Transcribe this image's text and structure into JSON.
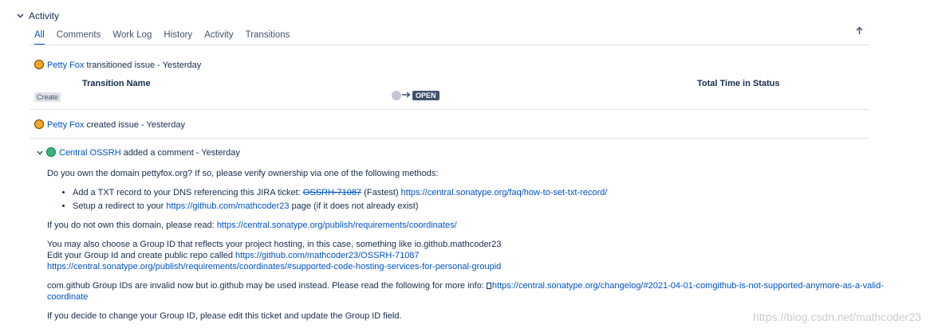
{
  "section": {
    "title": "Activity"
  },
  "tabs": [
    {
      "label": "All",
      "active": true
    },
    {
      "label": "Comments"
    },
    {
      "label": "Work Log"
    },
    {
      "label": "History"
    },
    {
      "label": "Activity"
    },
    {
      "label": "Transitions"
    }
  ],
  "entry1": {
    "user": "Petty Fox",
    "action": " transitioned issue - Yesterday",
    "table": {
      "col1": "Transition Name",
      "col2": "Total Time in Status",
      "row_transition": "Create",
      "row_status": "OPEN"
    }
  },
  "entry2": {
    "user": "Petty Fox",
    "action": " created issue - Yesterday"
  },
  "entry3": {
    "user": "Central OSSRH",
    "action": " added a comment - Yesterday",
    "body": {
      "p1": "Do you own the domain pettyfox.org? If so, please verify ownership via one of the following methods:",
      "li1_text": "Add a TXT record to your DNS referencing this JIRA ticket: ",
      "li1_ticket": "OSSRH-71087",
      "li1_mid": " (Fastest) ",
      "li1_link": "https://central.sonatype.org/faq/how-to-set-txt-record/",
      "li2_text": "Setup a redirect to your ",
      "li2_link": "https://github.com/mathcoder23",
      "li2_tail": " page (if it does not already exist)",
      "p2_text": "If you do not own this domain, please read: ",
      "p2_link": "https://central.sonatype.org/publish/requirements/coordinates/",
      "p3_line1": "You may also choose a Group ID that reflects your project hosting, in this case, something like io.github.mathcoder23",
      "p3_line2_text": "Edit your Group Id and create public repo called ",
      "p3_line2_link": "https://github.com/mathcoder23/OSSRH-71087",
      "p3_line3_link": "https://central.sonatype.org/publish/requirements/coordinates/#supported-code-hosting-services-for-personal-groupid",
      "p4_text": "com.github Group IDs are invalid now but io.github may be used instead. Please read the following for more info: ",
      "p4_link": "https://central.sonatype.org/changelog/#2021-04-01-comgithub-is-not-supported-anymore-as-a-valid-coordinate",
      "p5": "If you decide to change your Group ID, please edit this ticket and update the Group ID field."
    }
  },
  "watermark": "https://blog.csdn.net/mathcoder23",
  "colors": {
    "link": "#0052cc",
    "text": "#172b4d",
    "divider": "#dfe1e6",
    "status_open": "#42526e"
  }
}
